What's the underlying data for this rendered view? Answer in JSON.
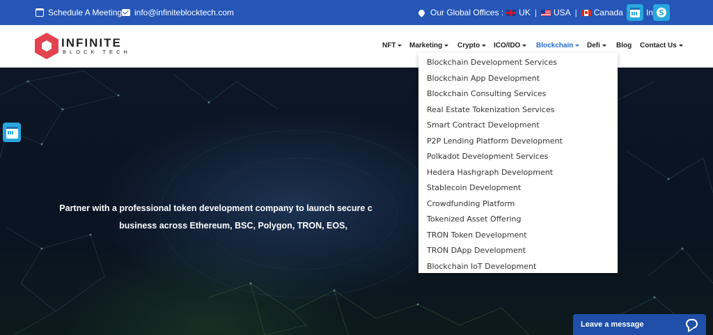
{
  "topbar": {
    "schedule_label": "Schedule A Meeting",
    "email": "info@infiniteblocktech.com",
    "offices_label": "Our Global Offices :",
    "offices": [
      "UK",
      "USA",
      "Canada",
      "India"
    ],
    "bg_color": "#2556b8"
  },
  "logo": {
    "name": "INFINITE",
    "tagline": "BLOCK TECH"
  },
  "nav": {
    "items": [
      {
        "label": "NFT",
        "has_caret": true
      },
      {
        "label": "Marketing",
        "has_caret": true
      },
      {
        "label": "Crypto",
        "has_caret": true
      },
      {
        "label": "ICO/IDO",
        "has_caret": true
      },
      {
        "label": "Blockchain",
        "has_caret": true,
        "active": true
      },
      {
        "label": "Defi",
        "has_caret": true
      },
      {
        "label": "Blog",
        "has_caret": false
      },
      {
        "label": "Contact Us",
        "has_caret": true
      }
    ],
    "active_color": "#2a6bc6"
  },
  "dropdown": {
    "items": [
      "Blockchain Development Services",
      "Blockchain App Development",
      "Blockchain Consulting Services",
      "Real Estate Tokenization Services",
      "Smart Contract Development",
      "P2P Lending Platform Development",
      "Polkadot Development Services",
      "Hedera Hashgraph Development",
      "Stablecoin Development",
      "Crowdfunding Platform",
      "Tokenized Asset Offering",
      "TRON Token Development",
      "TRON DApp Development",
      "Blockchain IoT Development"
    ]
  },
  "hero": {
    "line1": "Partner with a professional token development company to launch secure c",
    "line2": "business across Ethereum, BSC, Polygon, TRON, EOS,"
  },
  "chat": {
    "label": "Leave a message",
    "color": "#1f4fa8"
  }
}
